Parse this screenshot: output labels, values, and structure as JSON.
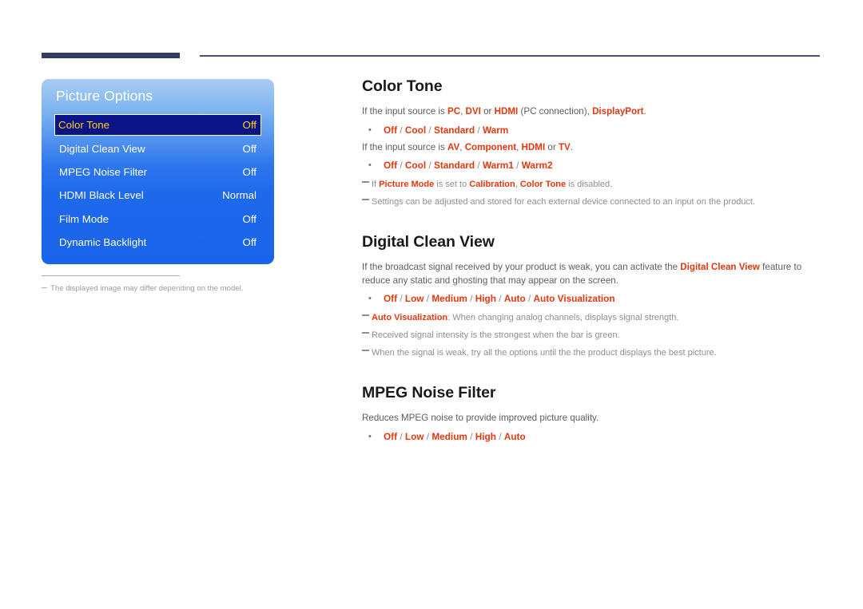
{
  "header": {
    "rule_thick_color": "#333a63",
    "rule_thin_color": "#4b5178"
  },
  "osd": {
    "title": "Picture Options",
    "selected_index": 0,
    "accent_selected_text": "#ffce1f",
    "panel_blue": "#1a64eb",
    "rows": [
      {
        "label": "Color Tone",
        "value": "Off"
      },
      {
        "label": "Digital Clean View",
        "value": "Off"
      },
      {
        "label": "MPEG Noise Filter",
        "value": "Off"
      },
      {
        "label": "HDMI Black Level",
        "value": "Normal"
      },
      {
        "label": "Film Mode",
        "value": "Off"
      },
      {
        "label": "Dynamic Backlight",
        "value": "Off"
      }
    ],
    "footnote": "The displayed image may differ depending on the model."
  },
  "sections": [
    {
      "title": "Color Tone",
      "intro1_a": "If the input source is ",
      "intro1_pc": "PC",
      "intro1_b": ", ",
      "intro1_dvi": "DVI",
      "intro1_c": " or ",
      "intro1_hdmi": "HDMI",
      "intro1_d": " (PC connection), ",
      "intro1_dp": "DisplayPort",
      "intro1_e": ".",
      "bullet1": {
        "dot": "•",
        "opt1": "Off",
        "sep1": " / ",
        "opt2": "Cool",
        "sep2": " / ",
        "opt3": "Standard",
        "sep3": " / ",
        "opt4": "Warm"
      },
      "intro2_a": "If the input source is ",
      "intro2_av": "AV",
      "intro2_b": ", ",
      "intro2_comp": "Component",
      "intro2_c": ", ",
      "intro2_hdmi": "HDMI",
      "intro2_d": " or ",
      "intro2_tv": "TV",
      "intro2_e": ".",
      "bullet2": {
        "dot": "•",
        "opt1": "Off",
        "sep1": " / ",
        "opt2": "Cool",
        "sep2": " / ",
        "opt3": "Standard",
        "sep3": " / ",
        "opt4": "Warm1",
        "sep4": " / ",
        "opt5": "Warm2"
      },
      "note1_a": "If ",
      "note1_b": "Picture Mode",
      "note1_c": " is set to ",
      "note1_d": "Calibration",
      "note1_e": ", ",
      "note1_f": "Color Tone",
      "note1_g": " is disabled.",
      "note2": "Settings can be adjusted and stored for each external device connected to an input on the product."
    },
    {
      "title": "Digital Clean View",
      "body_a": "If the broadcast signal received by your product is weak, you can activate the ",
      "body_b": "Digital Clean View",
      "body_c": " feature to reduce any static and ghosting that may appear on the screen.",
      "bullet": {
        "dot": "•",
        "opt1": "Off",
        "sep1": " / ",
        "opt2": "Low",
        "sep2": " / ",
        "opt3": "Medium",
        "sep3": " / ",
        "opt4": "High",
        "sep4": " / ",
        "opt5": "Auto",
        "sep5": " / ",
        "opt6": "Auto Visualization"
      },
      "note1_b": "Auto Visualization",
      "note1_c": ": When changing analog channels, displays signal strength.",
      "note2": "Received signal intensity is the strongest when the bar is green.",
      "note3": "When the signal is weak, try all the options until the the product displays the best picture."
    },
    {
      "title": "MPEG Noise Filter",
      "body": "Reduces MPEG noise to provide improved picture quality.",
      "bullet": {
        "dot": "•",
        "opt1": "Off",
        "sep1": " / ",
        "opt2": "Low",
        "sep2": " / ",
        "opt3": "Medium",
        "sep3": " / ",
        "opt4": "High",
        "sep4": " / ",
        "opt5": "Auto"
      }
    }
  ]
}
